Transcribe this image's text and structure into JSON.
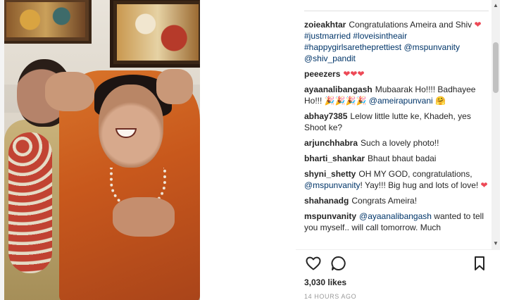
{
  "post": {
    "likes": "3,030 likes",
    "timestamp": "14 HOURS AGO"
  },
  "comments": [
    {
      "user": "zoieakhtar",
      "segments": [
        {
          "text": "Congratulations Ameira and Shiv "
        },
        {
          "text": "❤",
          "style": "heart"
        },
        {
          "text": " "
        },
        {
          "text": "#justmarried",
          "style": "tag"
        },
        {
          "text": " "
        },
        {
          "text": "#loveisintheair",
          "style": "tag"
        },
        {
          "text": " "
        },
        {
          "text": "#happygirlsaretheprettiest",
          "style": "tag"
        },
        {
          "text": " "
        },
        {
          "text": "@mspunvanity",
          "style": "tag"
        },
        {
          "text": " "
        },
        {
          "text": "@shiv_pandit",
          "style": "tag"
        }
      ]
    },
    {
      "user": "peeezers",
      "segments": [
        {
          "text": "❤❤❤",
          "style": "heart"
        }
      ]
    },
    {
      "user": "ayaanalibangash",
      "segments": [
        {
          "text": "Mubaarak Ho!!!! Badhayee Ho!!! "
        },
        {
          "text": "🎉🎉🎉🎉",
          "style": "party"
        },
        {
          "text": " "
        },
        {
          "text": "@ameirapunvani",
          "style": "tag"
        },
        {
          "text": " "
        },
        {
          "text": "🤗",
          "style": "party"
        }
      ]
    },
    {
      "user": "abhay7385",
      "segments": [
        {
          "text": "Lelow little lutte ke, Khadeh, yes Shoot ke?"
        }
      ]
    },
    {
      "user": "arjunchhabra",
      "segments": [
        {
          "text": "Such a lovely photo!!"
        }
      ]
    },
    {
      "user": "bharti_shankar",
      "segments": [
        {
          "text": "Bhaut bhaut badai"
        }
      ]
    },
    {
      "user": "shyni_shetty",
      "segments": [
        {
          "text": "OH MY GOD, congratulations, "
        },
        {
          "text": "@mspunvanity",
          "style": "tag"
        },
        {
          "text": "! Yay!!! Big hug and lots of love! "
        },
        {
          "text": "❤",
          "style": "heart"
        }
      ]
    },
    {
      "user": "shahanadg",
      "segments": [
        {
          "text": "Congrats Ameira!"
        }
      ]
    },
    {
      "user": "mspunvanity",
      "segments": [
        {
          "text": "@ayaanalibangash",
          "style": "tag"
        },
        {
          "text": " wanted to tell you myself.. will call tomorrow. Much"
        }
      ]
    }
  ],
  "icons": {
    "like": "heart-outline-icon",
    "comment": "speech-bubble-icon",
    "save": "bookmark-icon"
  },
  "colors": {
    "link": "#003569",
    "heart": "#ed4956",
    "text": "#262626",
    "muted": "#999999"
  }
}
